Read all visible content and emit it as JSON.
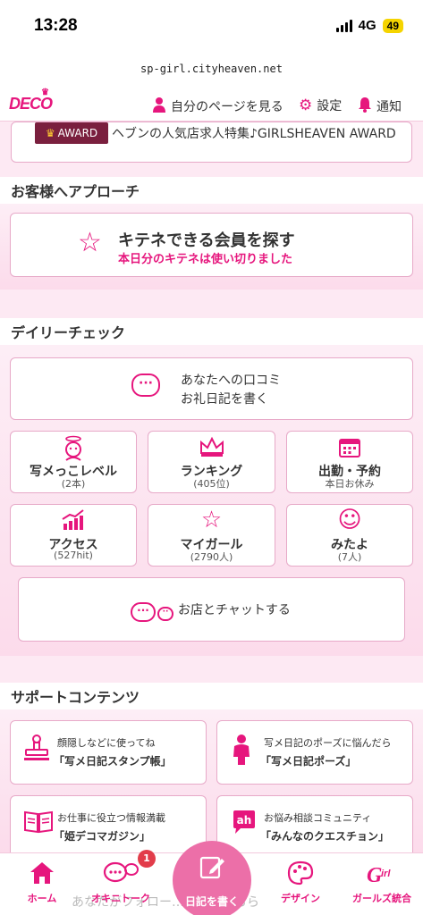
{
  "status": {
    "time": "13:28",
    "network": "4G",
    "battery": "49"
  },
  "url": "sp-girl.cityheaven.net",
  "header": {
    "logo": "DECO",
    "mypage": "自分のページを見る",
    "settings": "設定",
    "notify": "通知"
  },
  "award": {
    "badge": "AWARD",
    "text": "ヘブンの人気店求人特集♪GIRLSHEAVEN AWARD"
  },
  "approach": {
    "title": "お客様へアプローチ",
    "search_main": "キテネできる会員を探す",
    "search_sub": "本日分のキテネは使い切りました"
  },
  "daily": {
    "title": "デイリーチェック",
    "review_l1": "あなたへの口コミ",
    "review_l2": "お礼日記を書く",
    "tiles": [
      {
        "label": "写メっこレベル",
        "sub": "(2本)",
        "icon": "angel-icon"
      },
      {
        "label": "ランキング",
        "sub": "(405位)",
        "icon": "crown-icon"
      },
      {
        "label": "出勤・予約",
        "sub": "本日お休み",
        "icon": "calendar-icon"
      },
      {
        "label": "アクセス",
        "sub": "(527hit)",
        "icon": "chart-icon"
      },
      {
        "label": "マイガール",
        "sub": "(2790人)",
        "icon": "star-icon"
      },
      {
        "label": "みたよ",
        "sub": "(7人)",
        "icon": "smile-icon"
      }
    ],
    "chat": "お店とチャットする"
  },
  "support": {
    "title": "サポートコンテンツ",
    "items": [
      {
        "l1": "顔隠しなどに使ってね",
        "l2": "「写メ日記スタンプ帳」",
        "icon": "stamp-icon"
      },
      {
        "l1": "写メ日記のポーズに悩んだら",
        "l2": "「写メ日記ポーズ」",
        "icon": "pose-icon"
      },
      {
        "l1": "お仕事に役立つ情報満載",
        "l2": "「姫デコマガジン」",
        "icon": "magazine-icon"
      },
      {
        "l1": "お悩み相談コミュニティ",
        "l2": "「みんなのクエスチョン」",
        "icon": "question-icon"
      }
    ]
  },
  "tabbar": {
    "home": "ホーム",
    "talk": "オキニトーク",
    "talk_badge": "1",
    "write": "日記を書く",
    "design": "デザイン",
    "girls": "ガールズ統合",
    "faded": "あなたがフォロー…レベルごちら"
  }
}
